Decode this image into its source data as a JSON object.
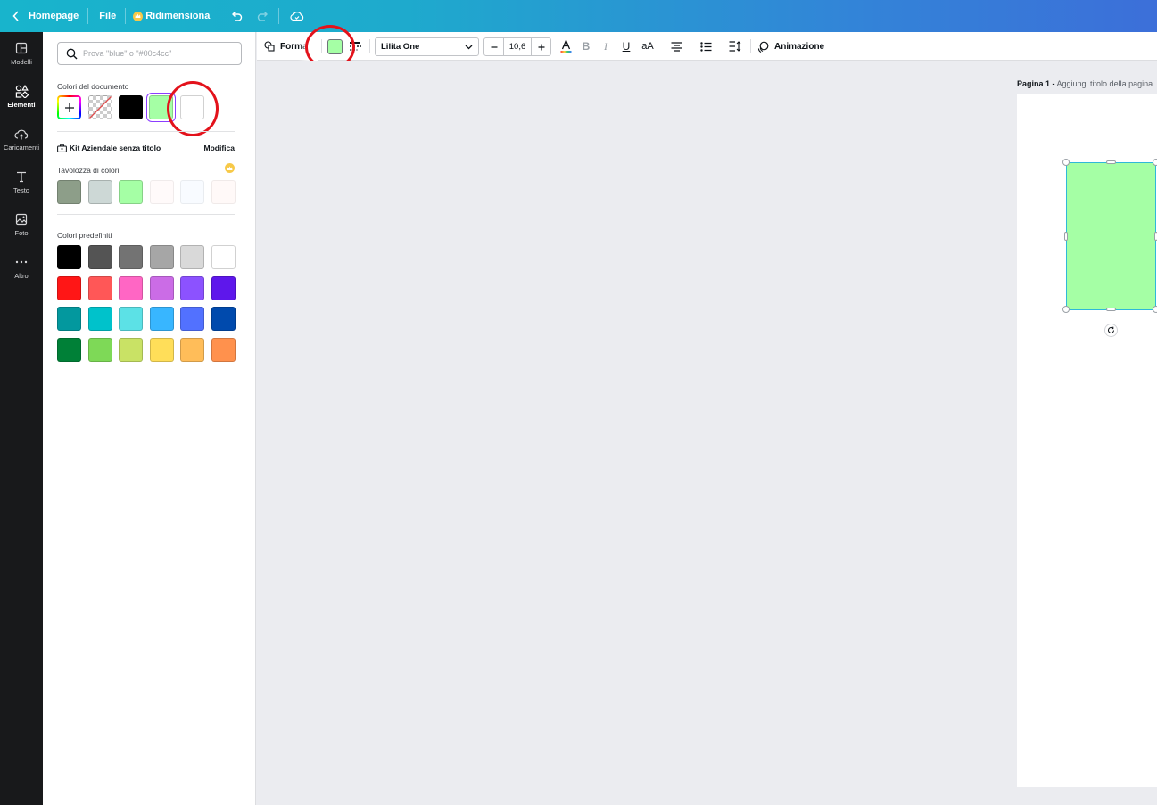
{
  "topbar": {
    "home": "Homepage",
    "file": "File",
    "resize": "Ridimensiona"
  },
  "rail": {
    "items": [
      {
        "label": "Modelli"
      },
      {
        "label": "Elementi"
      },
      {
        "label": "Caricamenti"
      },
      {
        "label": "Testo"
      },
      {
        "label": "Foto"
      },
      {
        "label": "Altro"
      }
    ]
  },
  "panel": {
    "search_placeholder": "Prova \"blue\" o \"#00c4cc\"",
    "document_colors_title": "Colori del documento",
    "document_colors": [
      "#000000",
      "#a5ffa5",
      "#ffffff"
    ],
    "brand_kit_title": "Kit Aziendale senza titolo",
    "brand_kit_edit": "Modifica",
    "palette_title": "Tavolozza di colori",
    "palette": [
      "#8d9e89",
      "#cdd8d6",
      "#a5ffa5",
      "#fffafa",
      "#f8fbff",
      "#fff9f8"
    ],
    "default_colors_title": "Colori predefiniti",
    "default_colors": [
      [
        "#000000",
        "#545454",
        "#737373",
        "#a6a6a6",
        "#d9d9d9",
        "#ffffff"
      ],
      [
        "#ff1616",
        "#ff5757",
        "#ff66c4",
        "#cb6ce6",
        "#8c52ff",
        "#5e17eb"
      ],
      [
        "#03989e",
        "#00c2cb",
        "#5ce1e6",
        "#38b6ff",
        "#5271ff",
        "#004aad"
      ],
      [
        "#008037",
        "#7ed957",
        "#c9e265",
        "#ffde59",
        "#ffbd59",
        "#ff914d"
      ]
    ]
  },
  "toolbar": {
    "shape_label": "Forma",
    "font_name": "Lilita One",
    "font_size": "10,6",
    "animation_label": "Animazione",
    "fill_color": "#a5ffa5"
  },
  "canvas": {
    "page_label_bold": "Pagina 1 -",
    "page_label_rest": " Aggiungi titolo della pagina",
    "shape_color": "#a5ffa5"
  }
}
